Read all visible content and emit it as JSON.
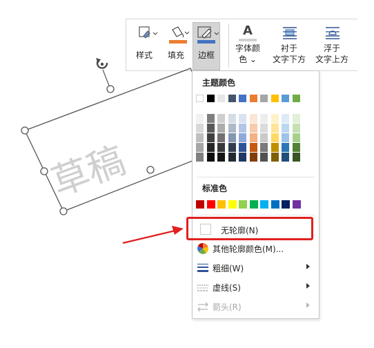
{
  "toolbar": {
    "style_label": "样式",
    "fill_label": "填充",
    "border_label": "边框",
    "font_color_label_1": "字体颜",
    "font_color_label_2": "色 ⌄",
    "font_color_glyph": "A",
    "behind_text_label_1": "衬于",
    "behind_text_label_2": "文字下方",
    "infront_text_label_1": "浮于",
    "infront_text_label_2": "文字上方",
    "fill_color": "#ed7d31",
    "border_color": "#4472c4"
  },
  "shape": {
    "text": "草稿",
    "rotate_icon": "rotate-handle-icon"
  },
  "dropdown": {
    "theme_colors_title": "主题颜色",
    "theme_colors": [
      "#ffffff",
      "#000000",
      "#e7e6e6",
      "#44546a",
      "#4472c4",
      "#ed7d31",
      "#a5a5a5",
      "#ffc000",
      "#5b9bd5",
      "#70ad47"
    ],
    "theme_shades": [
      [
        "#f2f2f2",
        "#d9d9d9",
        "#bfbfbf",
        "#a6a6a6",
        "#808080"
      ],
      [
        "#7f7f7f",
        "#595959",
        "#404040",
        "#262626",
        "#0d0d0d"
      ],
      [
        "#d0cece",
        "#aeabab",
        "#757171",
        "#3a3838",
        "#171616"
      ],
      [
        "#d6dce4",
        "#adb9ca",
        "#8497b0",
        "#333f4f",
        "#222a35"
      ],
      [
        "#d9e2f3",
        "#b4c6e7",
        "#8eaadb",
        "#2f5496",
        "#1f3864"
      ],
      [
        "#fbe5d5",
        "#f7cbac",
        "#f4b183",
        "#c55a11",
        "#833c0b"
      ],
      [
        "#ededed",
        "#dbdbdb",
        "#c9c9c9",
        "#7b7b7b",
        "#525252"
      ],
      [
        "#fff2cc",
        "#fee599",
        "#ffd965",
        "#bf9000",
        "#7f6000"
      ],
      [
        "#deebf6",
        "#bdd7ee",
        "#9dc3e6",
        "#2e75b5",
        "#1e4e79"
      ],
      [
        "#e2efd9",
        "#c5e0b3",
        "#a8d08d",
        "#538135",
        "#375623"
      ]
    ],
    "standard_colors_title": "标准色",
    "standard_colors": [
      "#c00000",
      "#ff0000",
      "#ffc000",
      "#ffff00",
      "#92d050",
      "#00b050",
      "#00b0f0",
      "#0070c0",
      "#002060",
      "#7030a0"
    ],
    "no_outline_label": "无轮廓(N)",
    "more_colors_label": "其他轮廓颜色(M)...",
    "weight_label": "粗细(W)",
    "dashes_label": "虚线(S)",
    "arrows_label": "箭头(R)"
  },
  "annotation": {
    "highlight_color": "#e02020",
    "arrow_color": "#e02020"
  }
}
